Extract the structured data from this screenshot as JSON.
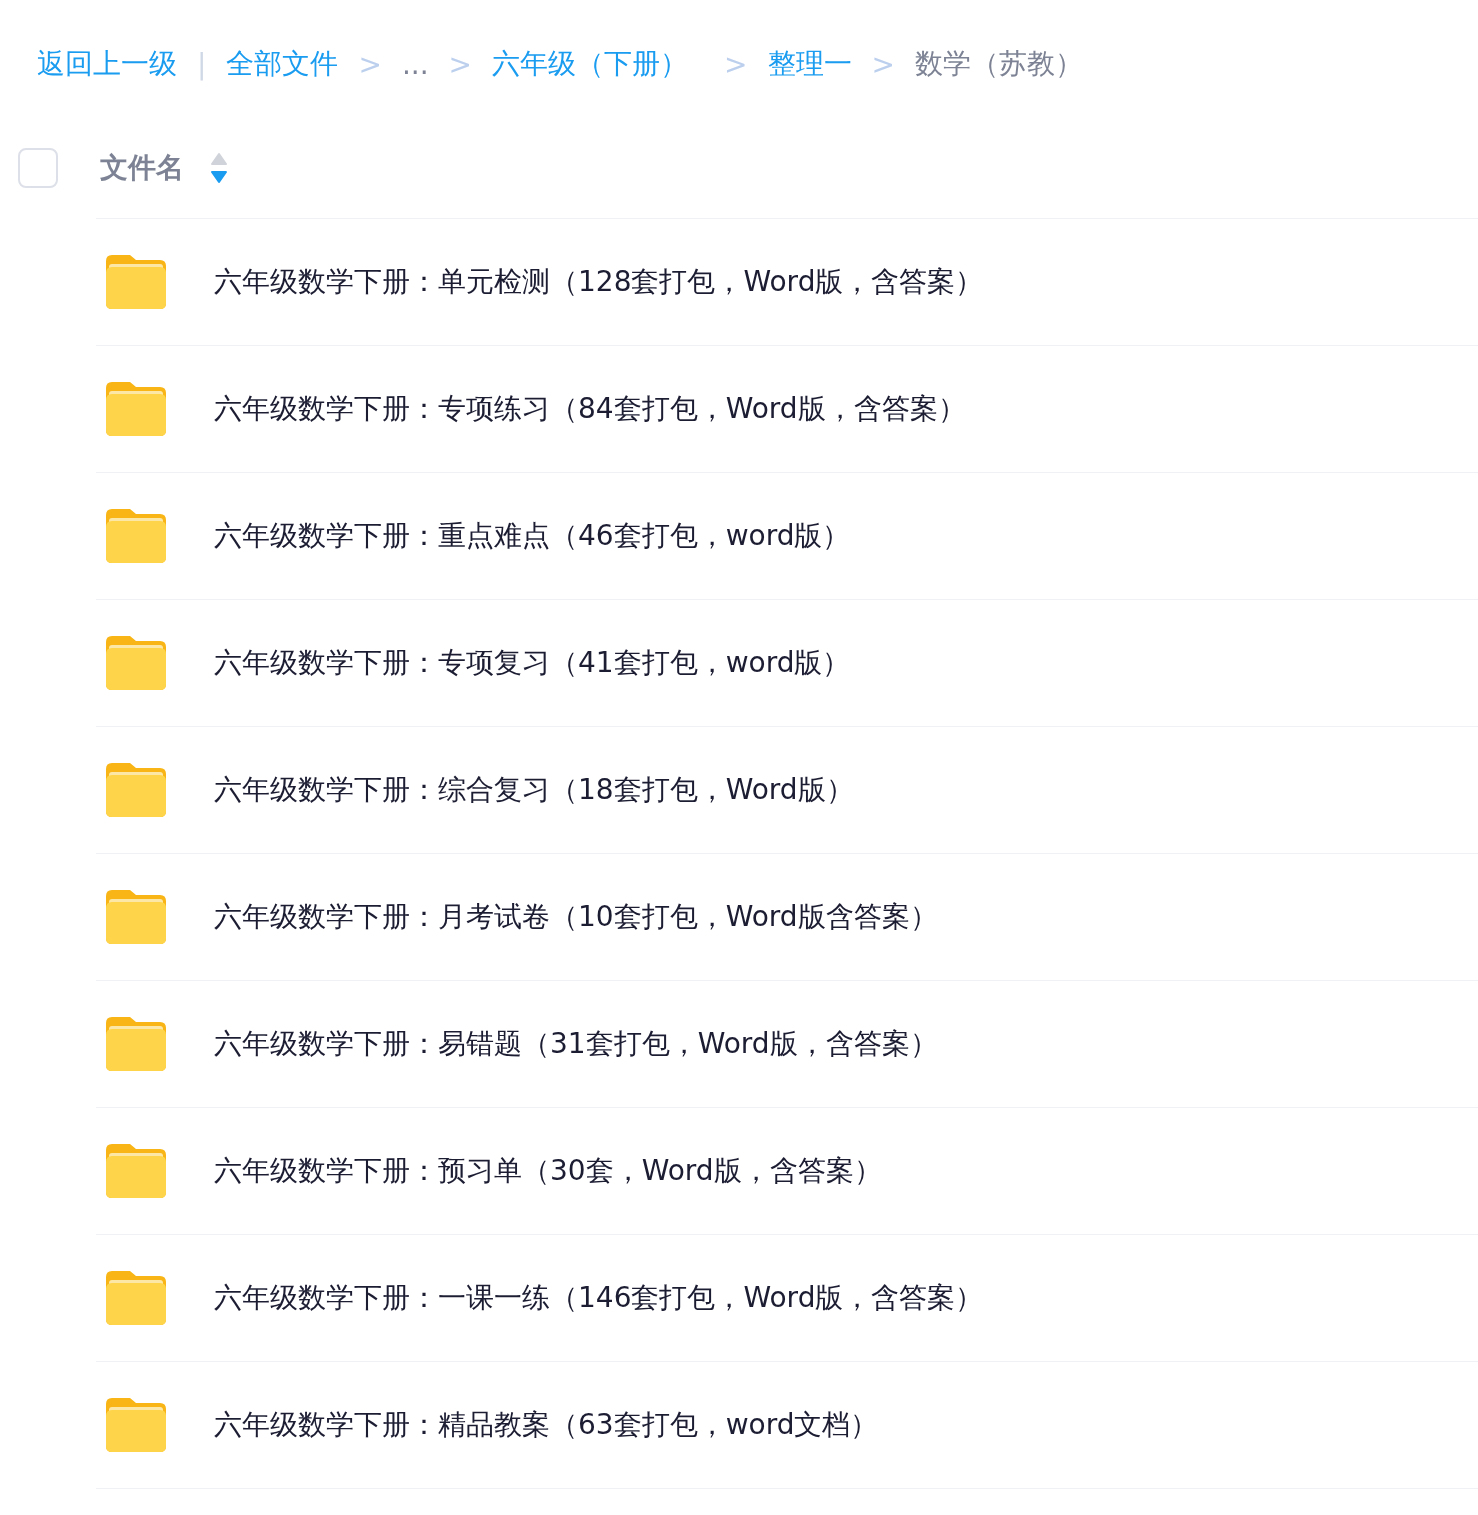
{
  "breadcrumb": [
    {
      "kind": "link",
      "label": "返回上一级"
    },
    {
      "kind": "divider",
      "label": "|"
    },
    {
      "kind": "link",
      "label": "全部文件"
    },
    {
      "kind": "separator",
      "label": ">"
    },
    {
      "kind": "ellipsis",
      "label": "..."
    },
    {
      "kind": "separator",
      "label": ">"
    },
    {
      "kind": "link",
      "label": "六年级（下册）"
    },
    {
      "kind": "separator",
      "label": ">"
    },
    {
      "kind": "link",
      "label": "整理一"
    },
    {
      "kind": "separator",
      "label": ">"
    },
    {
      "kind": "current",
      "label": "数学（苏教）"
    }
  ],
  "header": {
    "checked": false,
    "column": "文件名",
    "sort_ascending": false,
    "sort_descending": true
  },
  "rows": [
    {
      "name": "六年级数学下册：单元检测（128套打包，Word版，含答案）"
    },
    {
      "name": "六年级数学下册：专项练习（84套打包，Word版，含答案）"
    },
    {
      "name": "六年级数学下册：重点难点（46套打包，word版）"
    },
    {
      "name": "六年级数学下册：专项复习（41套打包，word版）"
    },
    {
      "name": "六年级数学下册：综合复习（18套打包，Word版）"
    },
    {
      "name": "六年级数学下册：月考试卷（10套打包，Word版含答案）"
    },
    {
      "name": "六年级数学下册：易错题（31套打包，Word版，含答案）"
    },
    {
      "name": "六年级数学下册：预习单（30套，Word版，含答案）"
    },
    {
      "name": "六年级数学下册：一课一练（146套打包，Word版，含答案）"
    },
    {
      "name": "六年级数学下册：精品教案（63套打包，word文档）"
    }
  ]
}
